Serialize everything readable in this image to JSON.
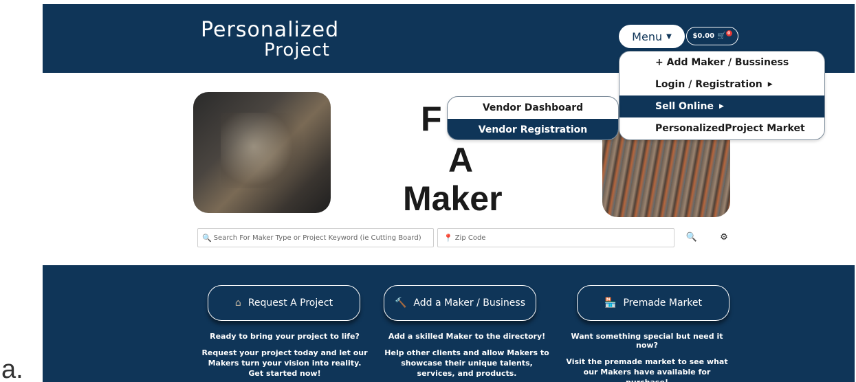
{
  "caption": "a.",
  "header": {
    "logo_line1": "Personalized",
    "logo_line2": "Project",
    "menu_label": "Menu",
    "cart_total": "$0.00",
    "cart_count": "0"
  },
  "hero": {
    "words": [
      "F",
      "A",
      "Maker"
    ]
  },
  "menu": {
    "items": [
      {
        "label": "+ Add Maker / Bussiness",
        "has_submenu": false
      },
      {
        "label": "Login / Registration",
        "has_submenu": true
      },
      {
        "label": "Sell Online",
        "has_submenu": true,
        "active": true
      },
      {
        "label": "PersonalizedProject Market",
        "has_submenu": false
      }
    ],
    "submenu": [
      {
        "label": "Vendor Dashboard"
      },
      {
        "label": "Vendor Registration",
        "active": true
      }
    ]
  },
  "search": {
    "placeholder": "Search For Maker Type or Project Keyword (ie Cutting Board)",
    "zip_placeholder": "Zip Code"
  },
  "cards": [
    {
      "button": "Request A Project",
      "icon": "home-icon",
      "heading": "Ready to bring your project to life?",
      "body": "Request your project today and let our Makers turn your vision into reality. Get started now!"
    },
    {
      "button": "Add a Maker / Business",
      "icon": "hammer-icon",
      "heading": "Add a skilled Maker to the directory!",
      "body": "Help other clients and allow Makers to showcase their unique talents, services, and products."
    },
    {
      "button": "Premade Market",
      "icon": "store-icon",
      "heading": "Want something special but need it now?",
      "body": "Visit the premade market to see what our Makers have available for purchase!"
    }
  ],
  "colors": {
    "navy": "#0f3558",
    "white": "#ffffff"
  }
}
